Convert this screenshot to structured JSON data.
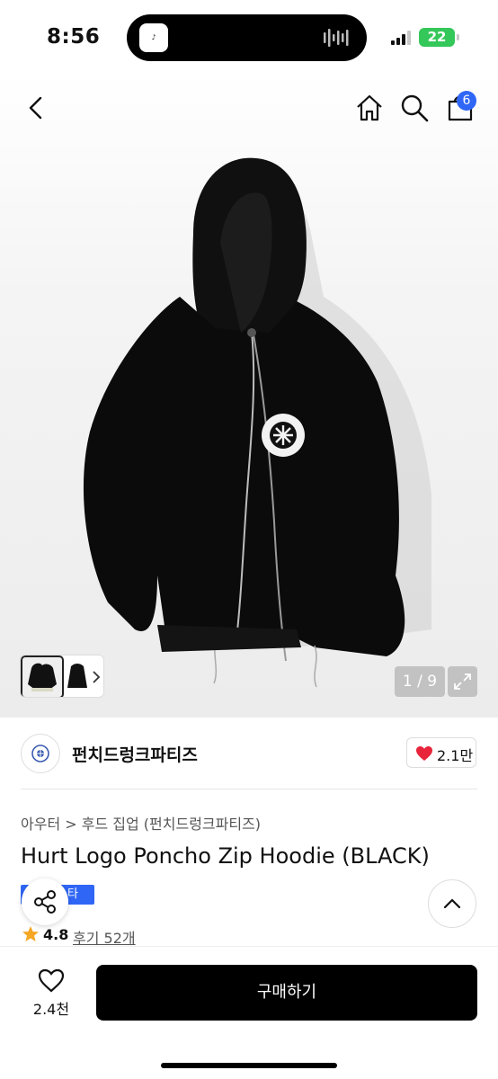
{
  "status_bar": {
    "time": "8:56",
    "battery": "22"
  },
  "product_image": {
    "counter": "1 / 9",
    "subject": "black zip hoodie with circular logo patch"
  },
  "header": {
    "cart_count": "6"
  },
  "brand": {
    "name": "펀치드렁크파티즈",
    "likes": "2.1만"
  },
  "product": {
    "breadcrumb": "아우터 > 후드 집업 (펀치드렁크파티즈)",
    "title": "Hurt Logo Poncho Zip Hoodie (BLACK)",
    "badge": "스타",
    "rating": "4.8",
    "reviews": "후기 52개"
  },
  "bottom": {
    "wish_count": "2.4천",
    "buy_label": "구매하기"
  },
  "colors": {
    "accent": "#2f66f6",
    "heart": "#e8253b",
    "battery": "#34c759",
    "buy": "#000000"
  }
}
